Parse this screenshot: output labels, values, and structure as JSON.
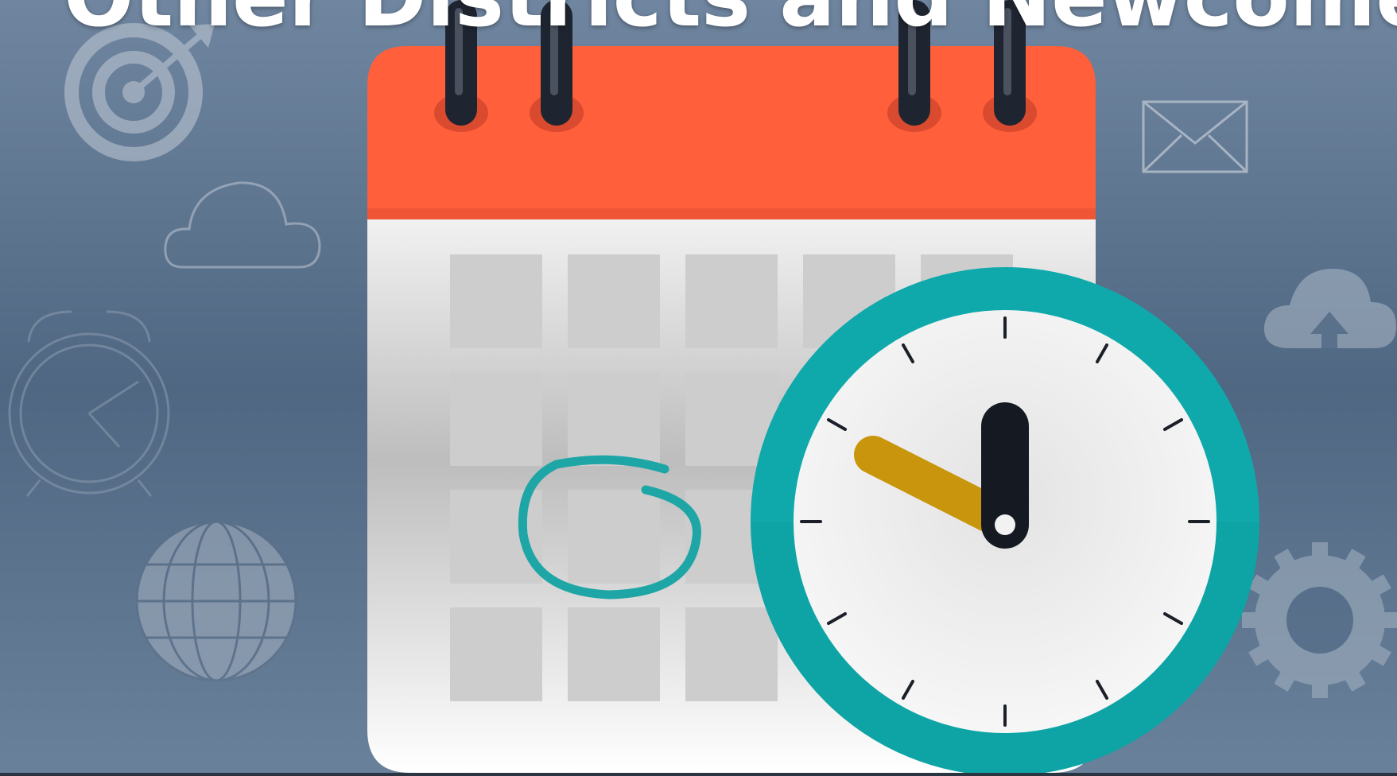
{
  "slide": {
    "title": "Other Districts and Newcomers"
  },
  "illustration": {
    "main_objects": [
      "calendar-icon",
      "clock-icon"
    ],
    "background_icons": [
      "target-icon",
      "cloud-icon",
      "alarm-clock-icon",
      "globe-icon",
      "envelope-icon",
      "cloud-upload-icon",
      "gear-icon"
    ],
    "colors": {
      "background_top": "#6b829c",
      "background_mid": "#4f6782",
      "calendar_header": "#ff5f3a",
      "calendar_body": "#f2f2f2",
      "calendar_cell": "#cfcfcf",
      "clock_ring": "#10a9ab",
      "clock_face": "#eeeeee",
      "hour_hand": "#c9950c",
      "minute_hand": "#151a22",
      "circle_mark": "#1ea6a6",
      "binder_ring": "#1f2530"
    }
  }
}
